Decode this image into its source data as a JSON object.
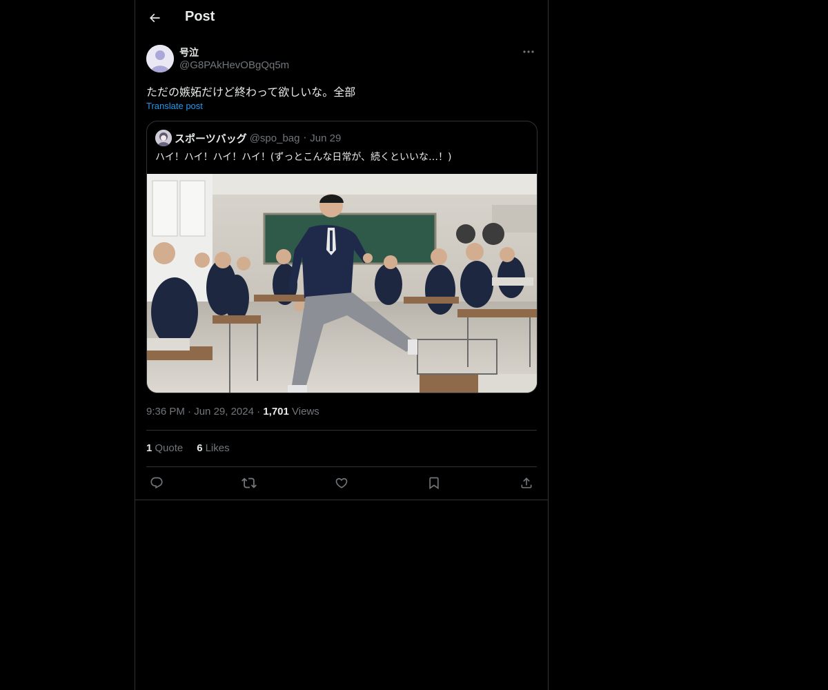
{
  "header": {
    "title": "Post"
  },
  "author": {
    "name": "号泣",
    "handle": "@G8PAkHevOBgQq5m"
  },
  "post": {
    "text": "ただの嫉妬だけど終わって欲しいな。全部",
    "translate_label": "Translate post"
  },
  "quote": {
    "name": "スポーツバッグ",
    "handle": "@spo_bag",
    "separator": "·",
    "date": "Jun 29",
    "text": "ハイ！ハイ！ハイ！ハイ！(ずっとこんな日常が、続くといいな…！)",
    "media": "classroom-photo"
  },
  "meta": {
    "time": "9:36 PM",
    "sep1": "·",
    "date": "Jun 29, 2024",
    "sep2": "·",
    "views_count": "1,701",
    "views_label": "Views"
  },
  "stats": {
    "quotes_count": "1",
    "quotes_label": "Quote",
    "likes_count": "6",
    "likes_label": "Likes"
  },
  "icons": [
    "back-arrow-icon",
    "more-icon",
    "reply-icon",
    "repost-icon",
    "like-icon",
    "bookmark-icon",
    "share-icon"
  ],
  "colors": {
    "background": "#000000",
    "text": "#e7e9ea",
    "secondary": "#71767b",
    "link": "#1d9bf0",
    "border": "#2f3336"
  }
}
